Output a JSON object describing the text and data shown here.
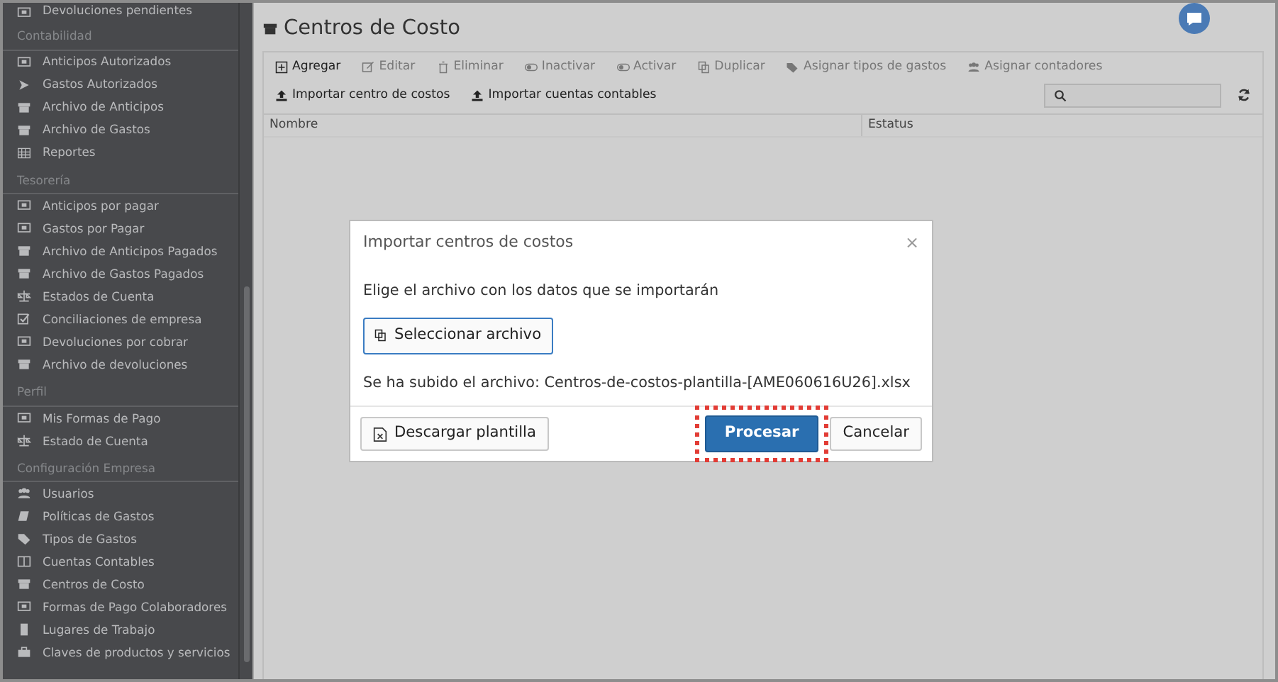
{
  "sidebar": {
    "top_items": [
      {
        "label": "Devoluciones pendientes"
      }
    ],
    "sections": [
      {
        "title": "Contabilidad",
        "items": [
          {
            "label": "Anticipos Autorizados"
          },
          {
            "label": "Gastos Autorizados"
          },
          {
            "label": "Archivo de Anticipos"
          },
          {
            "label": "Archivo de Gastos"
          },
          {
            "label": "Reportes"
          }
        ]
      },
      {
        "title": "Tesorería",
        "items": [
          {
            "label": "Anticipos por pagar"
          },
          {
            "label": "Gastos por Pagar"
          },
          {
            "label": "Archivo de Anticipos Pagados"
          },
          {
            "label": "Archivo de Gastos Pagados"
          },
          {
            "label": "Estados de Cuenta"
          },
          {
            "label": "Conciliaciones de empresa"
          },
          {
            "label": "Devoluciones por cobrar"
          },
          {
            "label": "Archivo de devoluciones"
          }
        ]
      },
      {
        "title": "Perfil",
        "items": [
          {
            "label": "Mis Formas de Pago"
          },
          {
            "label": "Estado de Cuenta"
          }
        ]
      },
      {
        "title": "Configuración Empresa",
        "items": [
          {
            "label": "Usuarios"
          },
          {
            "label": "Políticas de Gastos"
          },
          {
            "label": "Tipos de Gastos"
          },
          {
            "label": "Cuentas Contables"
          },
          {
            "label": "Centros de Costo"
          },
          {
            "label": "Formas de Pago Colaboradores"
          },
          {
            "label": "Lugares de Trabajo"
          },
          {
            "label": "Claves de productos y servicios"
          }
        ]
      }
    ]
  },
  "page": {
    "title": "Centros de Costo"
  },
  "toolbar": {
    "actions": [
      {
        "label": "Agregar",
        "disabled": false
      },
      {
        "label": "Editar",
        "disabled": true
      },
      {
        "label": "Eliminar",
        "disabled": true
      },
      {
        "label": "Inactivar",
        "disabled": true
      },
      {
        "label": "Activar",
        "disabled": true
      },
      {
        "label": "Duplicar",
        "disabled": true
      },
      {
        "label": "Asignar tipos de gastos",
        "disabled": true
      },
      {
        "label": "Asignar contadores",
        "disabled": true
      }
    ],
    "imports": [
      {
        "label": "Importar centro de costos"
      },
      {
        "label": "Importar cuentas contables"
      }
    ]
  },
  "table": {
    "columns": [
      "Nombre",
      "Estatus"
    ]
  },
  "modal": {
    "title": "Importar centros de costos",
    "close": "×",
    "instruction": "Elige el archivo con los datos que se importarán",
    "select_button": "Seleccionar archivo",
    "uploaded_text": "Se ha subido el archivo: Centros-de-costos-plantilla-[AME060616U26].xlsx",
    "download_button": "Descargar plantilla",
    "buttons": [
      {
        "label": "Procesar",
        "kind": "primary",
        "highlighted": true
      },
      {
        "label": "Cancelar",
        "kind": "secondary",
        "highlighted": false
      }
    ]
  }
}
